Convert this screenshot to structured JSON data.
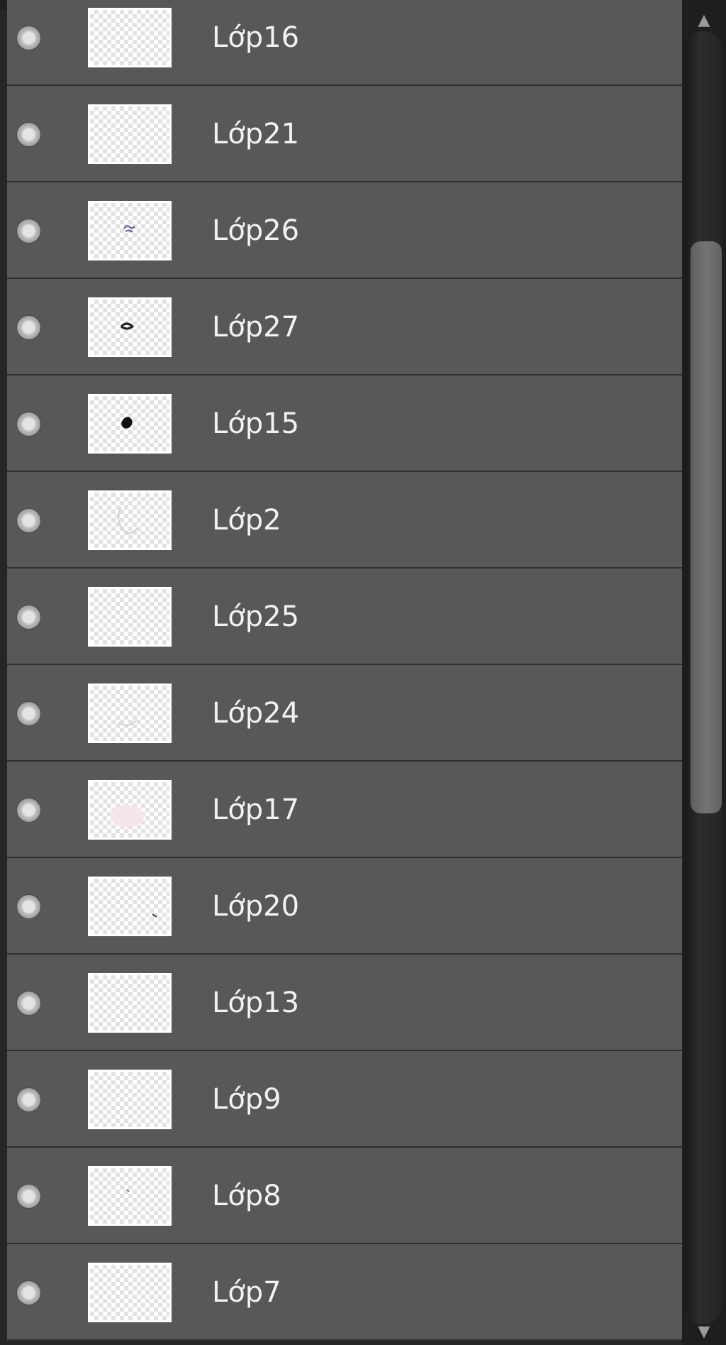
{
  "layers_panel": {
    "layers": [
      {
        "name": "Lớp16",
        "thumbnail_content": "empty"
      },
      {
        "name": "Lớp21",
        "thumbnail_content": "empty"
      },
      {
        "name": "Lớp26",
        "thumbnail_content": "blue-scribble"
      },
      {
        "name": "Lớp27",
        "thumbnail_content": "dark-stroke"
      },
      {
        "name": "Lớp15",
        "thumbnail_content": "black-blob"
      },
      {
        "name": "Lớp2",
        "thumbnail_content": "faint-outline"
      },
      {
        "name": "Lớp25",
        "thumbnail_content": "empty"
      },
      {
        "name": "Lớp24",
        "thumbnail_content": "faint-arc"
      },
      {
        "name": "Lớp17",
        "thumbnail_content": "pink-patch"
      },
      {
        "name": "Lớp20",
        "thumbnail_content": "small-mark"
      },
      {
        "name": "Lớp13",
        "thumbnail_content": "empty"
      },
      {
        "name": "Lớp9",
        "thumbnail_content": "empty"
      },
      {
        "name": "Lớp8",
        "thumbnail_content": "tiny-dot"
      },
      {
        "name": "Lớp7",
        "thumbnail_content": "empty"
      }
    ],
    "visibility_icon": "visibility-dot-icon",
    "scrollbar": {
      "up_arrow": "▲",
      "down_arrow": "▼",
      "scroll_position": 0.2
    }
  }
}
